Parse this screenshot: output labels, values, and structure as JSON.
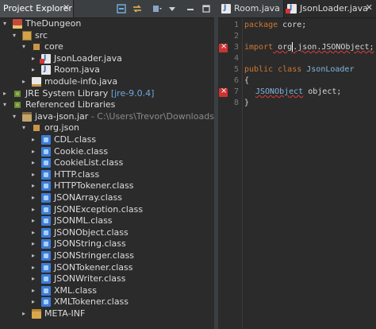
{
  "left_view": {
    "tab_label": "Project Explorer",
    "close_glyph": "✕"
  },
  "tree": [
    {
      "label": "TheDungeon",
      "arrow": "▾",
      "icon": "project-icon",
      "indent": 0
    },
    {
      "label": "src",
      "arrow": "▾",
      "icon": "source-folder-icon",
      "indent": 1
    },
    {
      "label": "core",
      "arrow": "▾",
      "icon": "package-icon",
      "indent": 2
    },
    {
      "label": "JsonLoader.java",
      "arrow": "▸",
      "icon": "java-file-error-icon",
      "indent": 3
    },
    {
      "label": "Room.java",
      "arrow": "▸",
      "icon": "java-file-icon",
      "indent": 3
    },
    {
      "label": "module-info.java",
      "arrow": "▸",
      "icon": "module-info-icon",
      "indent": 2
    },
    {
      "label": "JRE System Library",
      "suffix": "[jre-9.0.4]",
      "arrow": "▸",
      "icon": "library-icon",
      "indent": 0
    },
    {
      "label": "Referenced Libraries",
      "arrow": "▾",
      "icon": "library-icon",
      "indent": 0
    },
    {
      "label": "java-json.jar",
      "suffix": "- C:\\Users\\Trevor\\Downloads",
      "arrow": "▾",
      "icon": "jar-icon",
      "indent": 1
    },
    {
      "label": "org.json",
      "arrow": "▾",
      "icon": "package-icon",
      "indent": 2
    },
    {
      "label": "CDL.class",
      "arrow": "▸",
      "icon": "class-file-icon",
      "indent": 3
    },
    {
      "label": "Cookie.class",
      "arrow": "▸",
      "icon": "class-file-icon",
      "indent": 3
    },
    {
      "label": "CookieList.class",
      "arrow": "▸",
      "icon": "class-file-icon",
      "indent": 3
    },
    {
      "label": "HTTP.class",
      "arrow": "▸",
      "icon": "class-file-icon",
      "indent": 3
    },
    {
      "label": "HTTPTokener.class",
      "arrow": "▸",
      "icon": "class-file-icon",
      "indent": 3
    },
    {
      "label": "JSONArray.class",
      "arrow": "▸",
      "icon": "class-file-icon",
      "indent": 3
    },
    {
      "label": "JSONException.class",
      "arrow": "▸",
      "icon": "class-file-icon",
      "indent": 3
    },
    {
      "label": "JSONML.class",
      "arrow": "▸",
      "icon": "class-file-icon",
      "indent": 3
    },
    {
      "label": "JSONObject.class",
      "arrow": "▸",
      "icon": "class-file-icon",
      "indent": 3
    },
    {
      "label": "JSONString.class",
      "arrow": "▸",
      "icon": "class-file-icon",
      "indent": 3
    },
    {
      "label": "JSONStringer.class",
      "arrow": "▸",
      "icon": "class-file-icon",
      "indent": 3
    },
    {
      "label": "JSONTokener.class",
      "arrow": "▸",
      "icon": "class-file-icon",
      "indent": 3
    },
    {
      "label": "JSONWriter.class",
      "arrow": "▸",
      "icon": "class-file-icon",
      "indent": 3
    },
    {
      "label": "XML.class",
      "arrow": "▸",
      "icon": "class-file-icon",
      "indent": 3
    },
    {
      "label": "XMLTokener.class",
      "arrow": "▸",
      "icon": "class-file-icon",
      "indent": 3
    },
    {
      "label": "META-INF",
      "arrow": "▸",
      "icon": "folder-icon",
      "indent": 2
    }
  ],
  "editor": {
    "tabs": [
      {
        "label": "Room.java",
        "close": ""
      },
      {
        "label": "JsonLoader.java",
        "close": "✕"
      }
    ],
    "line_numbers": [
      "1",
      "2",
      "3",
      "4",
      "5",
      "6",
      "7",
      "8"
    ],
    "lines": {
      "l1_kw": "package",
      "l1_rest": " core;",
      "l3_kw": "import",
      "l3_a": " org",
      "l3_b": ".json.JSONObject;",
      "l5_kw": "public class",
      "l5_name": " JsonLoader",
      "l6": "{",
      "l7_type": "JSONObject",
      "l7_rest": " object;",
      "l8": "}"
    }
  },
  "colors": {
    "background": "#2b2b2b",
    "keyword": "#cc7832",
    "type": "#7fb5e0",
    "error": "#e03c3c"
  }
}
